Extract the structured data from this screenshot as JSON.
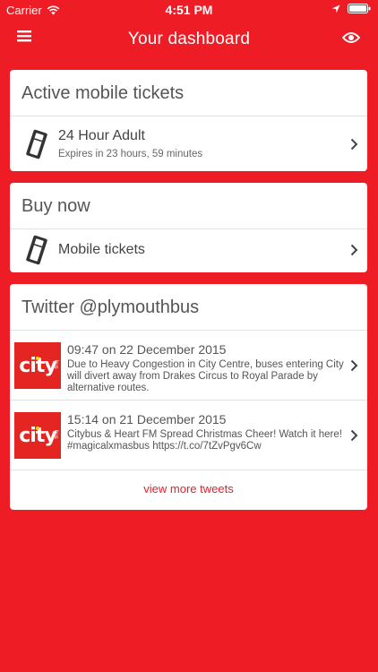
{
  "status_bar": {
    "carrier": "Carrier",
    "time": "4:51 PM"
  },
  "navbar": {
    "title": "Your dashboard"
  },
  "active_tickets": {
    "title": "Active mobile tickets",
    "items": [
      {
        "name": "24 Hour Adult",
        "expires": "Expires in 23 hours, 59 minutes"
      }
    ]
  },
  "buy_now": {
    "title": "Buy now",
    "items": [
      {
        "label": "Mobile tickets"
      }
    ]
  },
  "twitter": {
    "title": "Twitter @plymouthbus",
    "tweets": [
      {
        "when": "09:47 on 22 December 2015",
        "text": "Due to Heavy Congestion in City Centre, buses entering City will divert away from Drakes Circus to Royal Parade by alternative routes."
      },
      {
        "when": "15:14 on 21 December 2015",
        "text": "Citybus & Heart FM Spread Christmas Cheer! Watch it here! #magicalxmasbus https://t.co/7tZvPgv6Cw"
      }
    ],
    "avatar_logo": "city",
    "avatar_sub": "bus",
    "more_label": "view more tweets"
  },
  "colors": {
    "brand_red": "#EE1C25",
    "link_red": "#d8262b"
  }
}
